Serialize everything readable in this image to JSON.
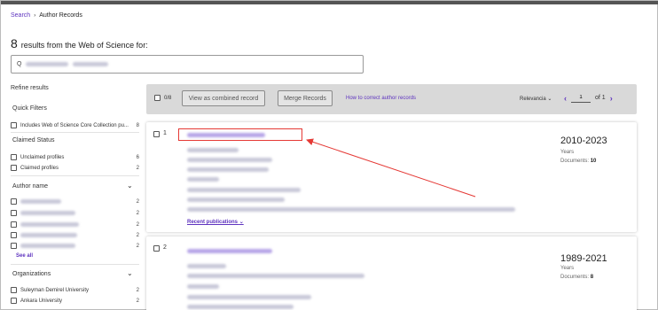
{
  "breadcrumb": {
    "search": "Search",
    "separator": "›",
    "current": "Author Records"
  },
  "results": {
    "count": "8",
    "text": "results from the Web of Science for:"
  },
  "sidebar": {
    "refine": "Refine results",
    "quick_filters": "Quick Filters",
    "quick_filter_item": {
      "label": "Includes Web of Science Core Collection pu...",
      "count": "8"
    },
    "claimed_status": "Claimed Status",
    "claimed_items": [
      {
        "label": "Unclaimed profiles",
        "count": "6"
      },
      {
        "label": "Claimed profiles",
        "count": "2"
      }
    ],
    "author_name": "Author name",
    "author_counts": [
      "2",
      "2",
      "2",
      "2",
      "2"
    ],
    "see_all": "See all",
    "organizations": "Organizations",
    "org_items": [
      {
        "label": "Suleyman Demirel University",
        "count": "2"
      },
      {
        "label": "Ankara University",
        "count": "2"
      }
    ]
  },
  "toolbar": {
    "select_count": "0/8",
    "view_combined": "View as combined record",
    "merge": "Merge Records",
    "correct_link": "How to correct author records",
    "sort": "Relevancia",
    "page": "1",
    "of": "of 1"
  },
  "records": [
    {
      "index": "1",
      "years": "2010-2023",
      "years_label": "Years",
      "docs_label": "Documents:",
      "docs": "10",
      "recent": "Recent publications"
    },
    {
      "index": "2",
      "years": "1989-2021",
      "years_label": "Years",
      "docs_label": "Documents:",
      "docs": "8"
    }
  ],
  "icons": {
    "search": "search-icon",
    "chevron": "chevron-down-icon",
    "prev": "chevron-left-icon",
    "next": "chevron-right-icon"
  },
  "colors": {
    "accent": "#5e33bf",
    "highlight": "#e53935"
  }
}
